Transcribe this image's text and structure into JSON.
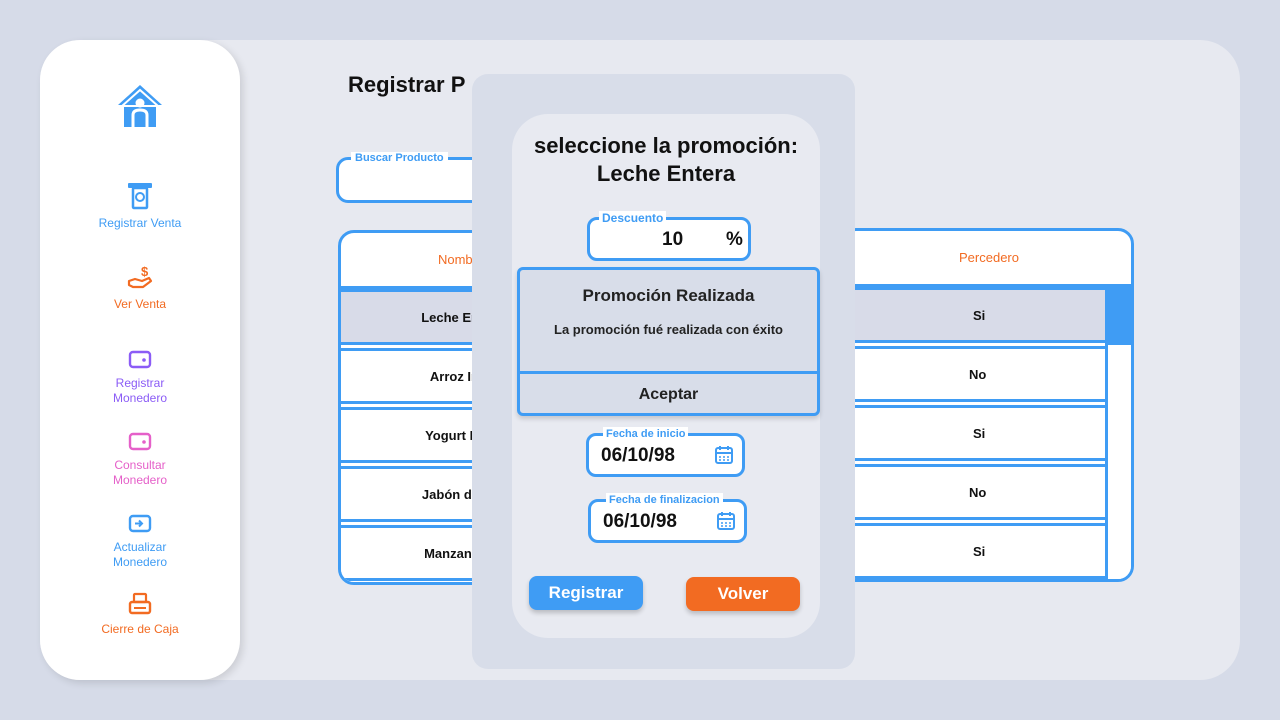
{
  "colors": {
    "accent": "#3f9cf4",
    "orange": "#f26b22",
    "purple": "#8b5cf6",
    "pink": "#e560c9"
  },
  "sidebar": {
    "home_icon": "home-icon",
    "items": [
      {
        "label": "Registrar Venta",
        "icon": "cash-register-icon",
        "color": "#3f9cf4"
      },
      {
        "label": "Ver Venta",
        "icon": "hand-money-icon",
        "color": "#f26b22"
      },
      {
        "label": "Registrar\nMonedero",
        "icon": "wallet-icon",
        "color": "#8b5cf6"
      },
      {
        "label": "Consultar\nMonedero",
        "icon": "wallet-icon",
        "color": "#e560c9"
      },
      {
        "label": "Actualizar\nMonedero",
        "icon": "wallet-transfer-icon",
        "color": "#3f9cf4"
      },
      {
        "label": "Cierre de Caja",
        "icon": "cash-drawer-icon",
        "color": "#f26b22"
      }
    ]
  },
  "main": {
    "title": "Registrar P",
    "search": {
      "label": "Buscar Producto",
      "value": ""
    },
    "table": {
      "col_name_header": "Nombr",
      "col_perishable_header": "Percedero",
      "rows": [
        {
          "name": "Leche En",
          "perishable": "Si"
        },
        {
          "name": "Arroz In",
          "perishable": "No"
        },
        {
          "name": "Yogurt N",
          "perishable": "Si"
        },
        {
          "name": "Jabón de",
          "perishable": "No"
        },
        {
          "name": "Manzana",
          "perishable": "Si"
        }
      ]
    }
  },
  "modal": {
    "title_line1": "seleccione la promoción:",
    "title_line2": "Leche Entera",
    "discount": {
      "label": "Descuento",
      "value": "10",
      "unit": "%"
    },
    "start_date": {
      "label": "Fecha de inicio",
      "value": "06/10/98"
    },
    "end_date": {
      "label": "Fecha de finalizacion",
      "value": "06/10/98"
    },
    "register_button": "Registrar",
    "back_button": "Volver"
  },
  "alert": {
    "title": "Promoción Realizada",
    "message": "La promoción fué realizada con éxito",
    "accept_button": "Aceptar"
  }
}
